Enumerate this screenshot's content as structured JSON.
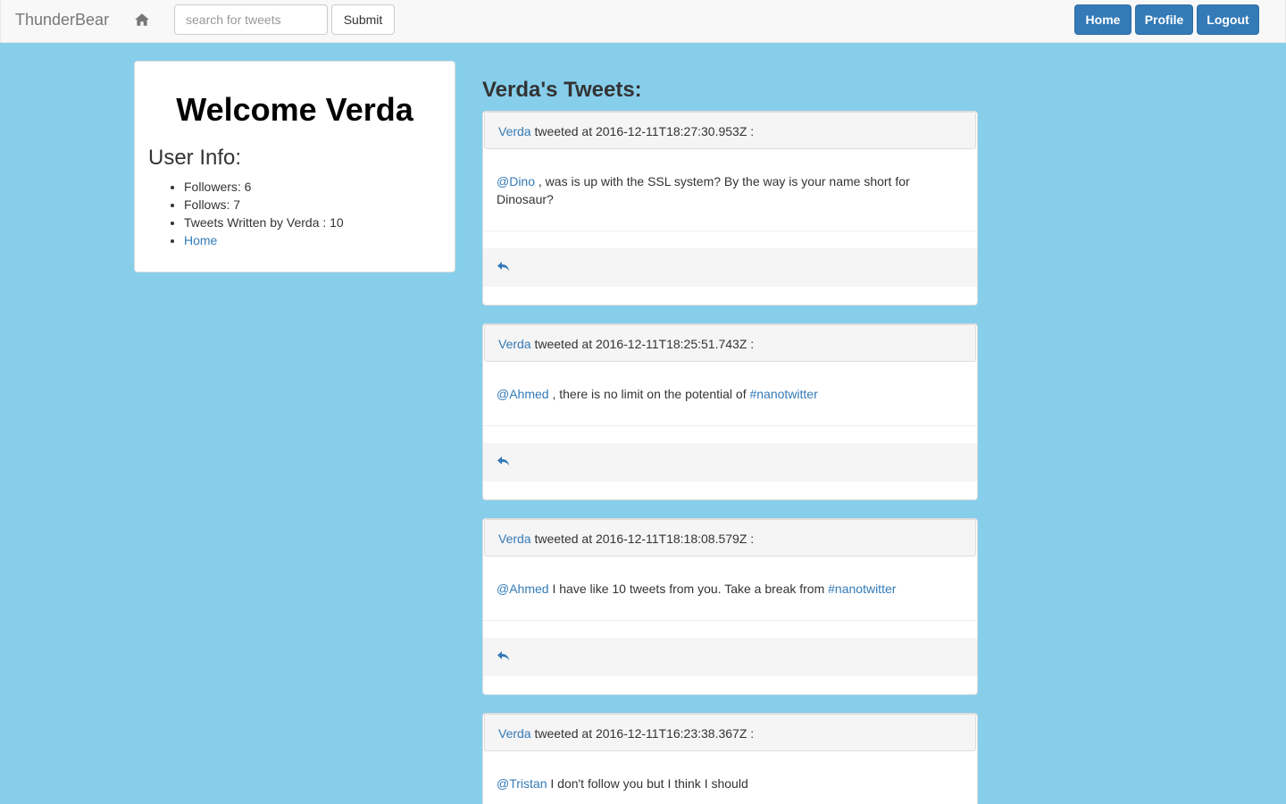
{
  "navbar": {
    "brand": "ThunderBear",
    "home_icon": "home-icon",
    "search_placeholder": "search for tweets",
    "submit_label": "Submit",
    "buttons": {
      "home": "Home",
      "profile": "Profile",
      "logout": "Logout"
    }
  },
  "user_panel": {
    "welcome": "Welcome Verda",
    "info_title": "User Info:",
    "followers": "Followers: 6",
    "follows": "Follows: 7",
    "tweets_written": "Tweets Written by Verda : 10",
    "home_link": "Home"
  },
  "tweets_title": "Verda's Tweets:",
  "tweets": [
    {
      "author": "Verda",
      "meta": " tweeted at 2016-12-11T18:27:30.953Z :",
      "mention": "@Dino",
      "text": " , was is up with the SSL system? By the way is your name short for Dinosaur?",
      "hashtag": ""
    },
    {
      "author": "Verda",
      "meta": " tweeted at 2016-12-11T18:25:51.743Z :",
      "mention": "@Ahmed",
      "text": " , there is no limit on the potential of ",
      "hashtag": "#nanotwitter"
    },
    {
      "author": "Verda",
      "meta": " tweeted at 2016-12-11T18:18:08.579Z :",
      "mention": "@Ahmed",
      "text": " I have like 10 tweets from you. Take a break from ",
      "hashtag": "#nanotwitter"
    },
    {
      "author": "Verda",
      "meta": " tweeted at 2016-12-11T16:23:38.367Z :",
      "mention": "@Tristan",
      "text": " I don't follow you but I think I should",
      "hashtag": ""
    }
  ],
  "colors": {
    "background": "#87ceeb",
    "link": "#337ab7",
    "button": "#337ab7"
  },
  "icons": {
    "reply": "reply-icon"
  }
}
